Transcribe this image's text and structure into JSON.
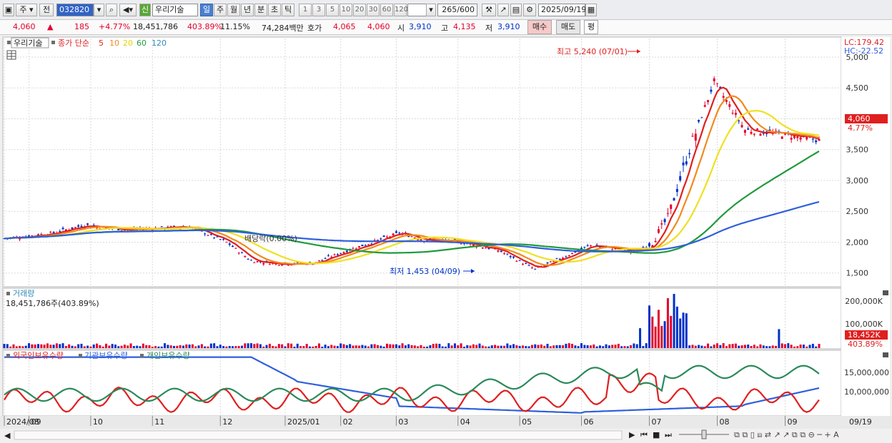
{
  "toolbar": {
    "period_type": "주",
    "prev_label": "전",
    "code": "032820",
    "new_badge": "신",
    "stock_name": "우리기술",
    "periods": [
      "일",
      "주",
      "월",
      "년",
      "분",
      "초",
      "틱"
    ],
    "active_period": "일",
    "intervals": [
      "1",
      "3",
      "5",
      "10",
      "20",
      "30",
      "60",
      "120"
    ],
    "count": "265",
    "count_total": "/600",
    "date": "2025/09/19"
  },
  "price_bar": {
    "price": "4,060",
    "change": "185",
    "change_pct": "+4.77%",
    "volume": "18,451,786",
    "volume_ratio": "403.89%",
    "turnover": "11.15%",
    "amount": "74,284백만",
    "quote_label": "호가",
    "ask": "4,065",
    "bid": "4,060",
    "open_label": "시",
    "open": "3,910",
    "high_label": "고",
    "high": "4,135",
    "low_label": "저",
    "low": "3,910",
    "buy_label": "매수",
    "sell_label": "매도",
    "avg_label": "평"
  },
  "price_panel": {
    "stock_label": "우리기술",
    "ma_label": "종가 단순",
    "ma_periods": [
      "5",
      "10",
      "20",
      "60",
      "120"
    ],
    "lc": "LC:179.42",
    "hc": "HC:-22.52",
    "y_ticks": [
      "5,000",
      "4,500",
      "4,000",
      "3,500",
      "3,000",
      "2,500",
      "2,000",
      "1,500"
    ],
    "high_annotation": "최고 5,240 (07/01)",
    "low_annotation": "최저 1,453 (04/09)",
    "dividend_annotation": "배당락(0.00%)",
    "last_price_tag": "4,060",
    "last_pct_tag": "4.77%"
  },
  "volume_panel": {
    "title": "거래량",
    "value": "18,451,786주(403.89%)",
    "y_ticks": [
      "200,000K",
      "100,000K"
    ],
    "tag": "18,452K",
    "tag_pct": "403.89%"
  },
  "holding_panel": {
    "titles": [
      "외국인보유수량",
      "기관보유수량",
      "개인보유수량"
    ],
    "y_ticks": [
      "15,000,000",
      "10,000,000"
    ]
  },
  "x_axis": {
    "labels": [
      "2024/08",
      "09",
      "10",
      "11",
      "12",
      "2025/01",
      "02",
      "03",
      "04",
      "05",
      "06",
      "07",
      "08",
      "09"
    ],
    "last_date": "09/19"
  },
  "colors": {
    "up": "#e4002b",
    "down": "#0030c8",
    "ma5": "#e01f1f",
    "ma10": "#f08a1e",
    "ma20": "#f0e020",
    "ma60": "#1f9a3c",
    "ma120": "#2e5fdc",
    "foreign": "#e01f1f",
    "institution": "#2e5fdc",
    "individual": "#2a8a5a"
  },
  "chart_data": {
    "type": "line",
    "x": [
      0,
      8,
      16,
      26,
      30,
      40,
      50,
      60,
      72,
      80,
      88,
      100,
      112,
      120,
      124,
      128,
      136,
      148,
      160,
      172,
      190,
      205,
      210,
      215,
      222,
      230,
      240,
      252,
      264,
      265
    ],
    "series": [
      {
        "name": "종가",
        "values": [
          2060,
          2100,
          2150,
          2280,
          2250,
          2200,
          2230,
          2250,
          2000,
          1700,
          1650,
          1660,
          1880,
          2010,
          2080,
          2150,
          2040,
          2000,
          1870,
          1560,
          1950,
          1840,
          2000,
          2400,
          3500,
          4600,
          3820,
          3750,
          3650,
          3980
        ]
      }
    ],
    "ylim": [
      1300,
      5300
    ]
  }
}
